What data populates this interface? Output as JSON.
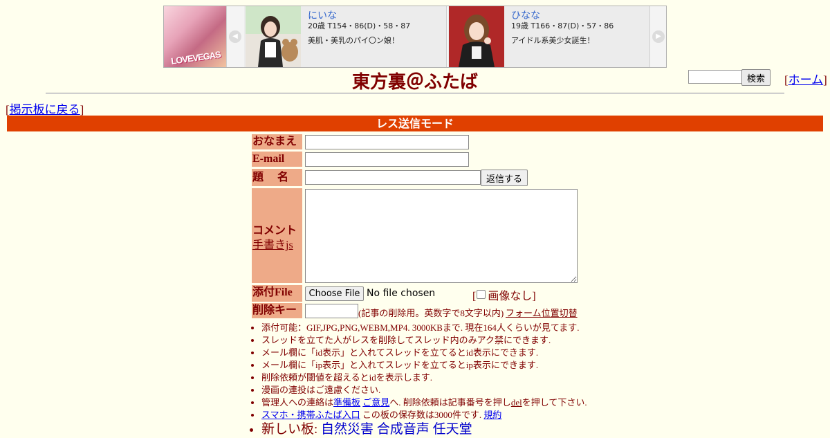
{
  "banner": {
    "logo_text": "LOVEVEGAS",
    "cards": [
      {
        "name": "にいな",
        "stats": "20歳 T154・86(D)・58・87",
        "desc": "美肌・美乳のパイ〇ン娘！"
      },
      {
        "name": "ひなな",
        "stats": "19歳 T166・87(D)・57・86",
        "desc": "アイドル系美少女誕生！"
      }
    ],
    "prev_glyph": "◀",
    "next_glyph": "▶"
  },
  "site_title": "東方裏＠ふたば",
  "search": {
    "value": "",
    "button_label": "検索"
  },
  "home": {
    "open": "[",
    "label": "ホーム",
    "close": "]"
  },
  "back": {
    "open": "[",
    "label": "掲示板に戻る",
    "close": "]"
  },
  "mode_bar": "レス送信モード",
  "form": {
    "name_label": "おなまえ",
    "email_label": "E-mail",
    "subject_label": "題　 名",
    "submit_label": "返信する",
    "comment_label": "コメント",
    "handwrite_link": "手書きjs",
    "file_label": "添付File",
    "file_button": "Choose File",
    "file_status": "No file chosen",
    "noimage_open": "[",
    "noimage_label": "画像なし",
    "noimage_close": "]",
    "delkey_label": "削除キー",
    "delkey_note": "(記事の削除用。英数字で8文字以内)",
    "form_position_link": "フォーム位置切替"
  },
  "rules": {
    "r1": "添付可能：GIF,JPG,PNG,WEBM,MP4. 3000KBまで. 現在164人くらいが見てます.",
    "r2": "スレッドを立てた人がレスを削除してスレッド内のみアク禁にできます.",
    "r3": "メール欄に「id表示」と入れてスレッドを立てるとid表示にできます.",
    "r4": "メール欄に「ip表示」と入れてスレッドを立てるとip表示にできます.",
    "r5": "削除依頼が閾値を超えるとidを表示します.",
    "r6": "漫画の連投はご遠慮ください.",
    "r7_pre": "管理人への連絡は",
    "r7_link1": "準備板",
    "r7_link2": "ご意見",
    "r7_mid": "へ. 削除依頼は記事番号を押し",
    "r7_link3": "del",
    "r7_post": "を押して下さい.",
    "r8_link": "スマホ・携帯ふたば入口",
    "r8_mid": " この板の保存数は3000件です. ",
    "r8_link2": "規約",
    "r9_pre": "新しい板: ",
    "r9_link1": "自然災害",
    "r9_link2": "合成音声",
    "r9_link3": "任天堂"
  }
}
